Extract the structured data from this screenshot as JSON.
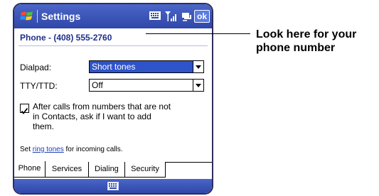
{
  "title_bar": {
    "app_title": "Settings",
    "ok_label": "ok"
  },
  "header": {
    "phone_label": "Phone - (408) 555-2760"
  },
  "form": {
    "dialpad": {
      "label": "Dialpad:",
      "value": "Short tones"
    },
    "tty": {
      "label": "TTY/TTD:",
      "value": "Off"
    },
    "checkbox": {
      "checked": true,
      "line1": "After calls from numbers that are not",
      "line2": "in Contacts, ask if I want to add",
      "line3": "them."
    },
    "ring_tones": {
      "prefix": "Set ",
      "link": "ring tones",
      "suffix": " for incoming calls."
    }
  },
  "tabs": [
    {
      "label": "Phone",
      "active": true
    },
    {
      "label": "Services",
      "active": false
    },
    {
      "label": "Dialing",
      "active": false
    },
    {
      "label": "Security",
      "active": false
    }
  ],
  "callout": {
    "line1": "Look here for your",
    "line2": "phone number"
  },
  "icons": {
    "start": "windows-flag-icon",
    "keyboard": "keyboard-icon",
    "signal": "signal-strength-icon",
    "connectivity": "connectivity-icon",
    "input_panel": "keyboard-icon"
  },
  "colors": {
    "titlebar": "#3a55b8",
    "header_text": "#1f2f8a",
    "selection": "#2f53c9",
    "link": "#1f3fb8"
  }
}
